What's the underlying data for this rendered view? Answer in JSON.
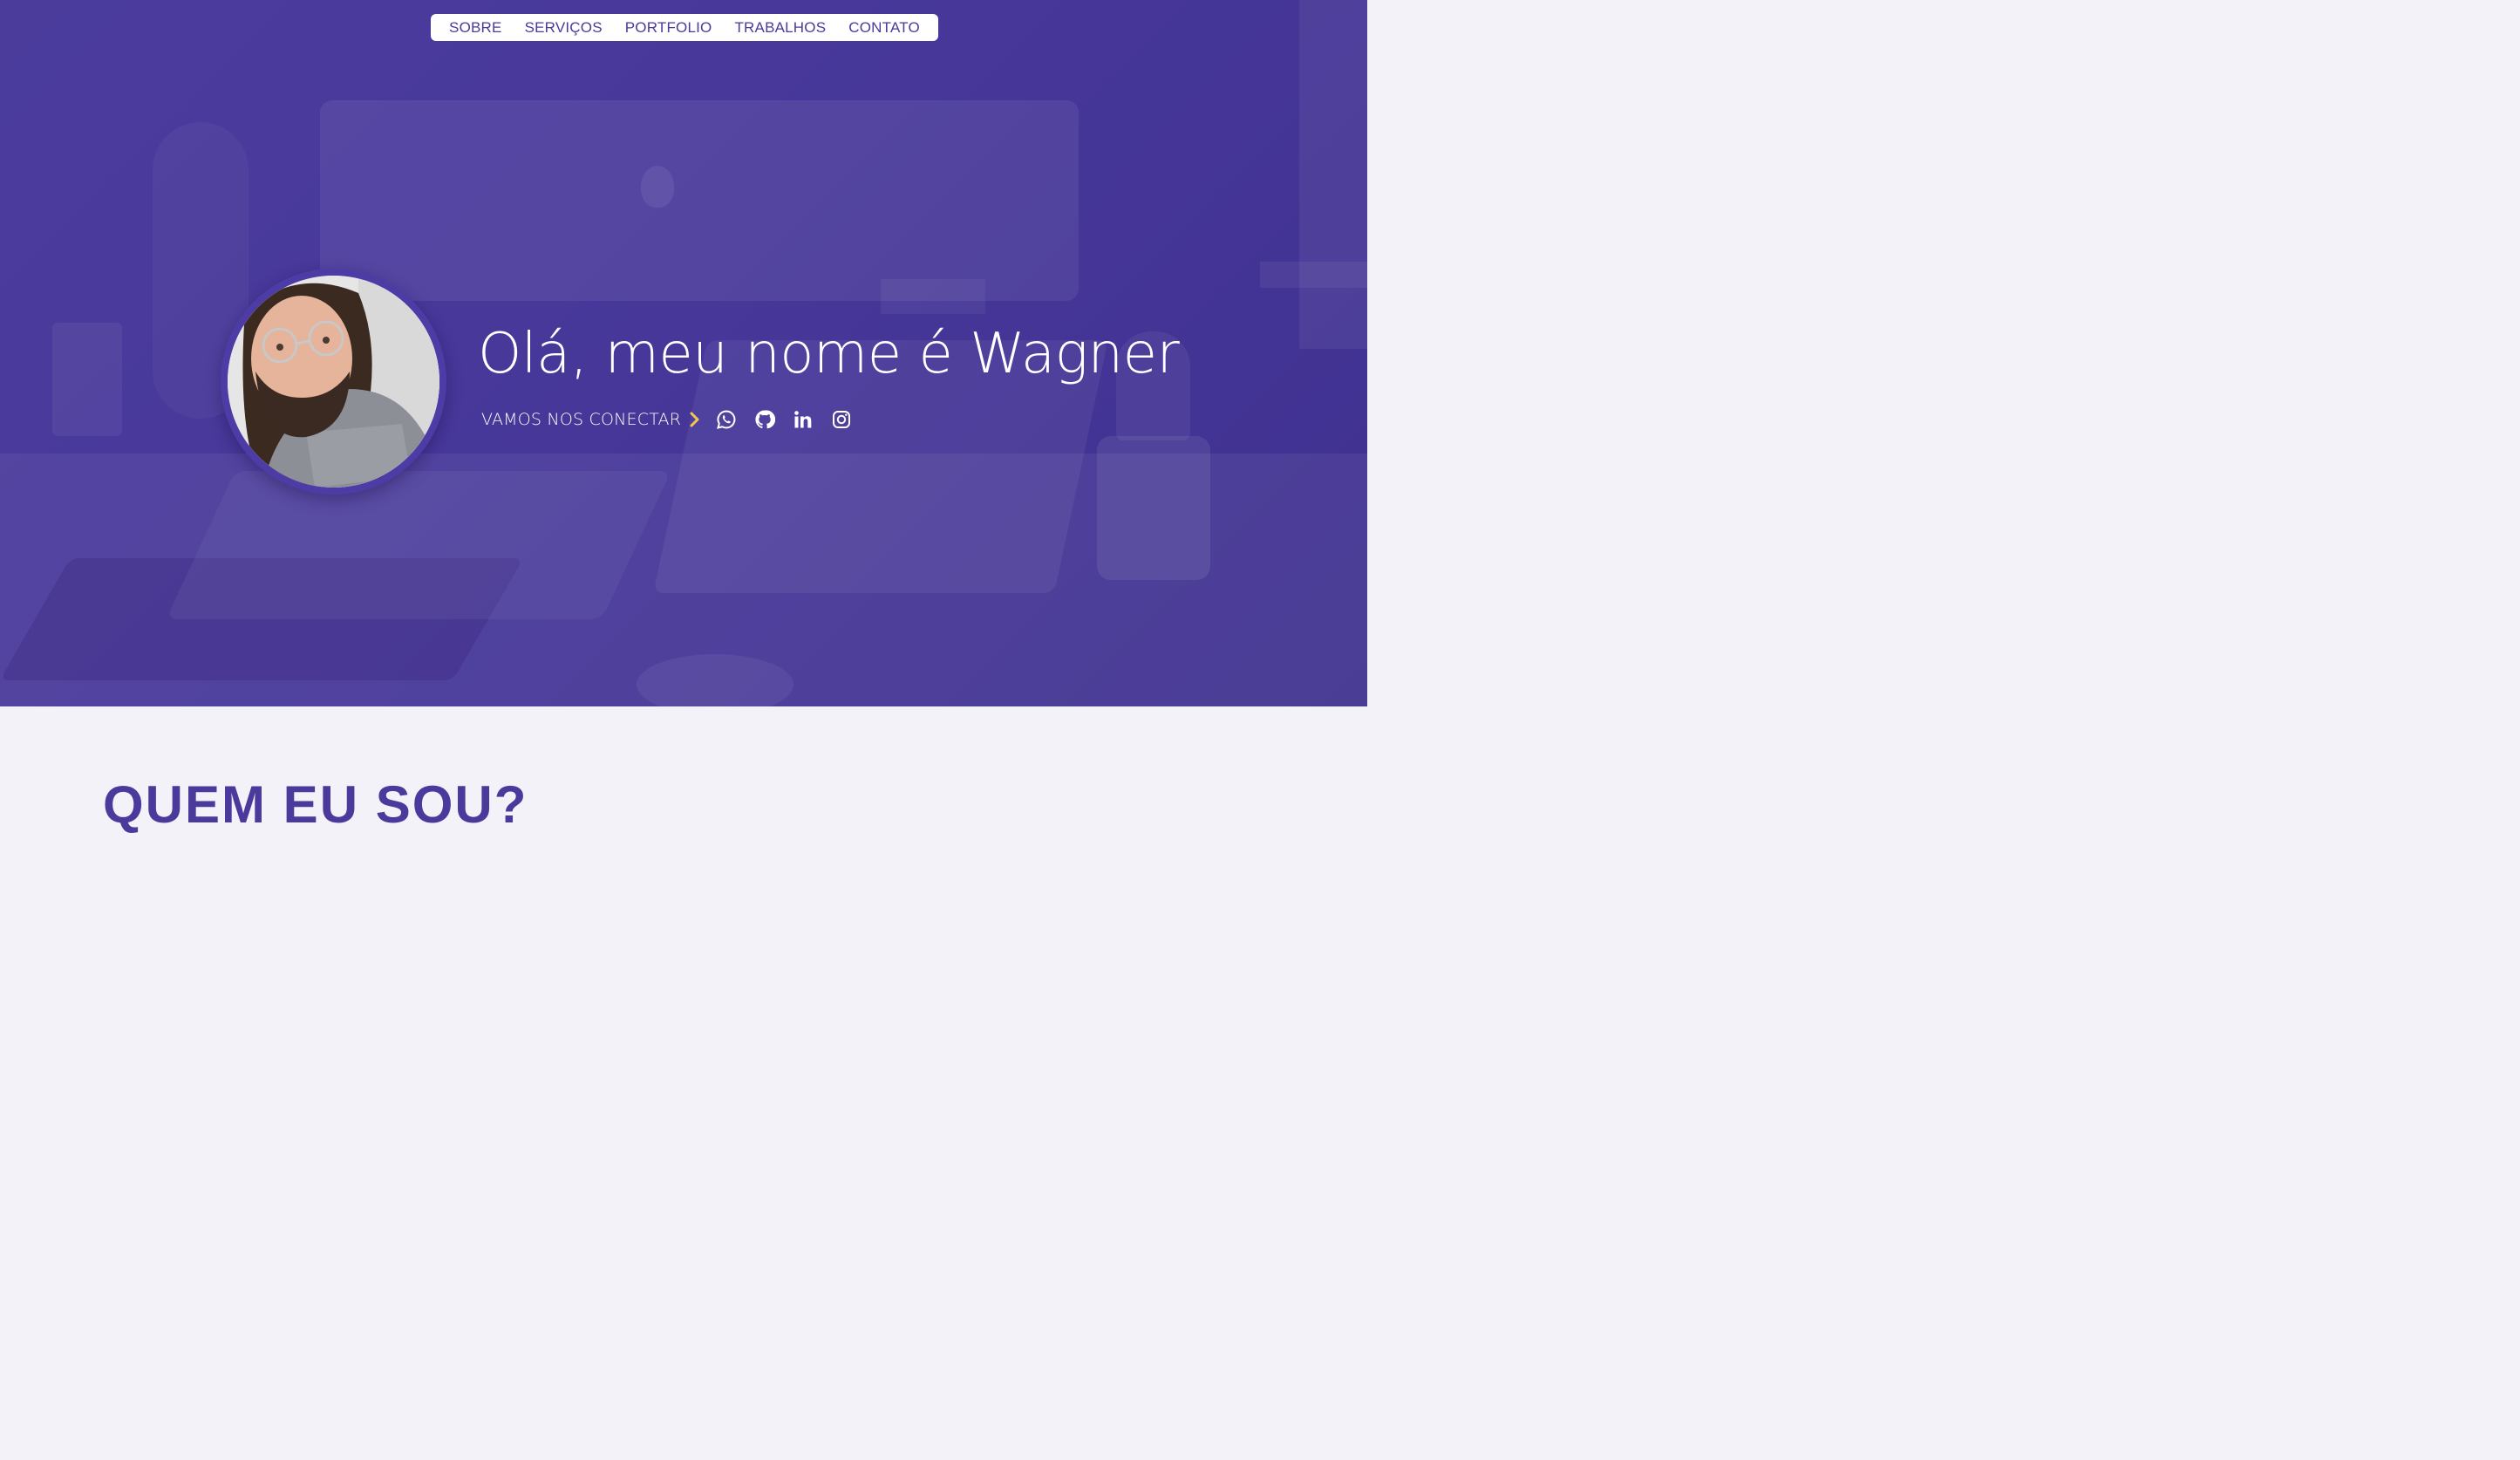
{
  "nav": {
    "items": [
      {
        "label": "SOBRE"
      },
      {
        "label": "SERVIÇOS"
      },
      {
        "label": "PORTFOLIO"
      },
      {
        "label": "TRABALHOS"
      },
      {
        "label": "CONTATO"
      }
    ]
  },
  "hero": {
    "headline": "Olá, meu nome é Wagner",
    "connect_label": "VAMOS NOS CONECTAR",
    "social_icons": [
      "whatsapp-icon",
      "github-icon",
      "linkedin-icon",
      "instagram-icon"
    ],
    "avatar_icon": "profile-photo"
  },
  "about": {
    "title": "QUEM EU SOU?"
  },
  "colors": {
    "primary": "#4b3a9c",
    "hero_bg": "#47389a",
    "accent_chevron": "#f2c94c",
    "page_bg": "#f3f2f8"
  }
}
